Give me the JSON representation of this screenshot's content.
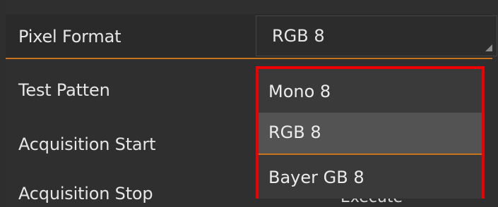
{
  "properties": {
    "pixel_format": {
      "label": "Pixel Format",
      "value": "RGB 8"
    },
    "test_pattern": {
      "label": "Test Patten"
    },
    "acquisition_start": {
      "label": "Acquisition Start"
    },
    "acquisition_stop": {
      "label": "Acquisition Stop",
      "button_label": "Execute"
    }
  },
  "dropdown": {
    "options": [
      "Mono 8",
      "RGB 8",
      "Bayer GB 8"
    ],
    "selected": "RGB 8"
  },
  "colors": {
    "background": "#2e2e2e",
    "accent": "#c8741f",
    "highlight_border": "#ee0000",
    "selected_option": "#535353"
  }
}
